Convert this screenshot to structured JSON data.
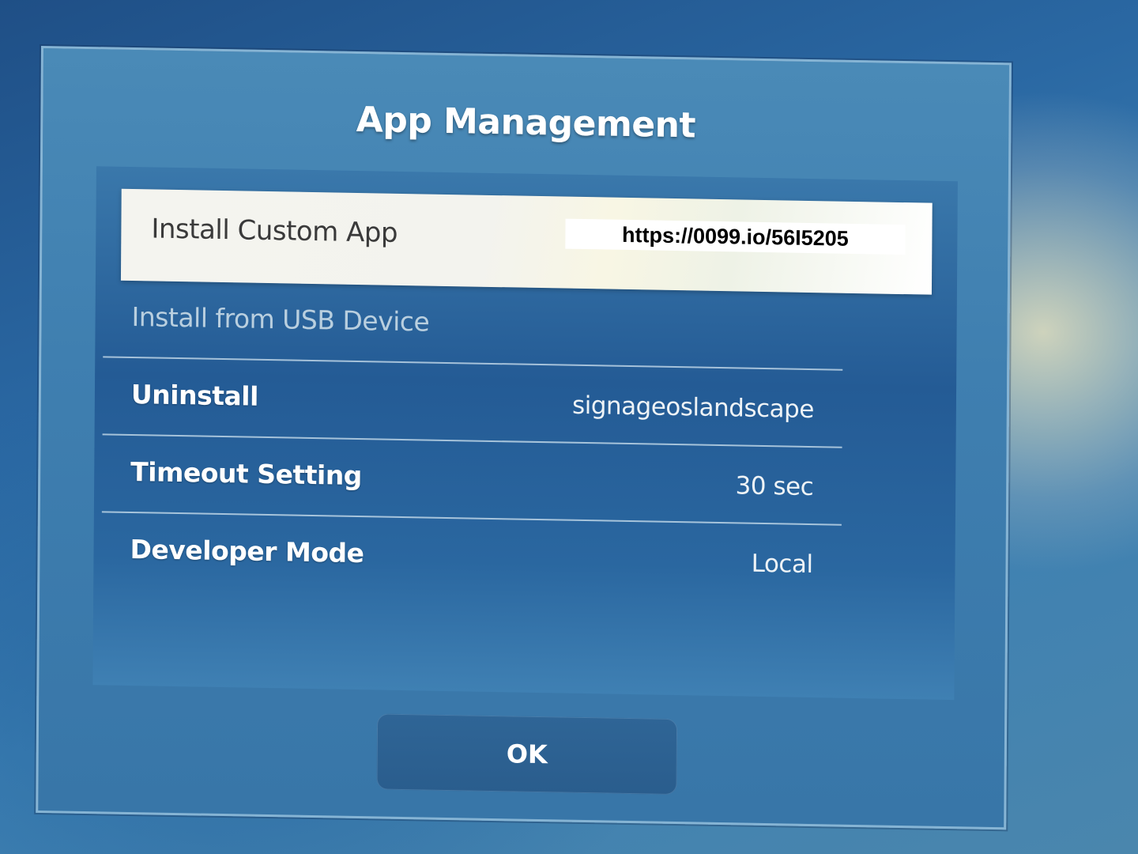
{
  "dialog": {
    "title": "App Management",
    "items": [
      {
        "label": "Install Custom App",
        "value": "https://0099.io/56I5205",
        "state": "selected"
      },
      {
        "label": "Install from USB Device",
        "value": "",
        "state": "disabled"
      },
      {
        "label": "Uninstall",
        "value": "signageoslandscape",
        "state": "normal"
      },
      {
        "label": "Timeout Setting",
        "value": "30 sec",
        "state": "normal"
      },
      {
        "label": "Developer Mode",
        "value": "Local",
        "state": "normal"
      }
    ],
    "ok_label": "OK"
  }
}
